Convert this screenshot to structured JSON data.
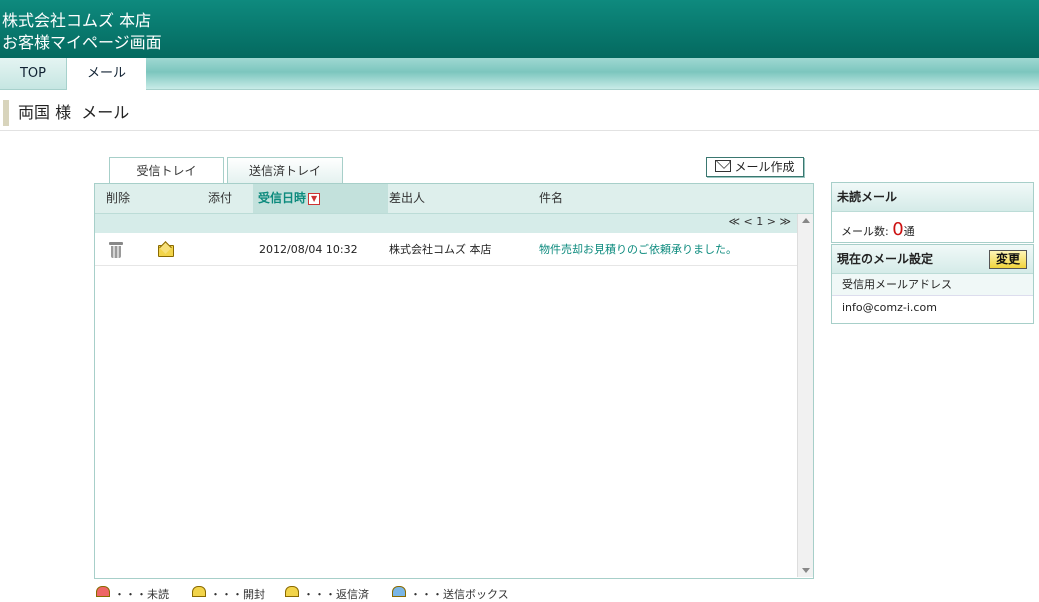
{
  "header": {
    "company": "株式会社コムズ 本店",
    "subtitle": "お客様マイページ画面"
  },
  "nav": {
    "tabs": [
      {
        "label": "TOP",
        "active": false
      },
      {
        "label": "メール",
        "active": true
      }
    ]
  },
  "page_title": "両国 様  メール",
  "tabs": {
    "inbox": "受信トレイ",
    "sent": "送信済トレイ"
  },
  "compose_button": "メール作成",
  "mail_table": {
    "columns": {
      "delete": "削除",
      "attach": "添付",
      "received": "受信日時",
      "sender": "差出人",
      "subject": "件名"
    },
    "pager": "≪ < 1 > ≫",
    "rows": [
      {
        "datetime": "2012/08/04 10:32",
        "sender": "株式会社コムズ 本店",
        "subject": "物件売却お見積りのご依頼承りました。"
      }
    ]
  },
  "legend": {
    "unread": "・・・未読",
    "read": "・・・開封",
    "replied": "・・・返信済",
    "outbox": "・・・送信ボックス"
  },
  "unread_panel": {
    "title": "未読メール",
    "count_label": "メール数:",
    "count": "0",
    "unit": "通"
  },
  "settings_panel": {
    "title": "現在のメール設定",
    "change_button": "変更",
    "address_label": "受信用メールアドレス",
    "address": "info@comz-i.com"
  },
  "colors": {
    "header_green": "#04695f",
    "accent_teal": "#0b8a7d",
    "count_red": "#cc1111"
  }
}
